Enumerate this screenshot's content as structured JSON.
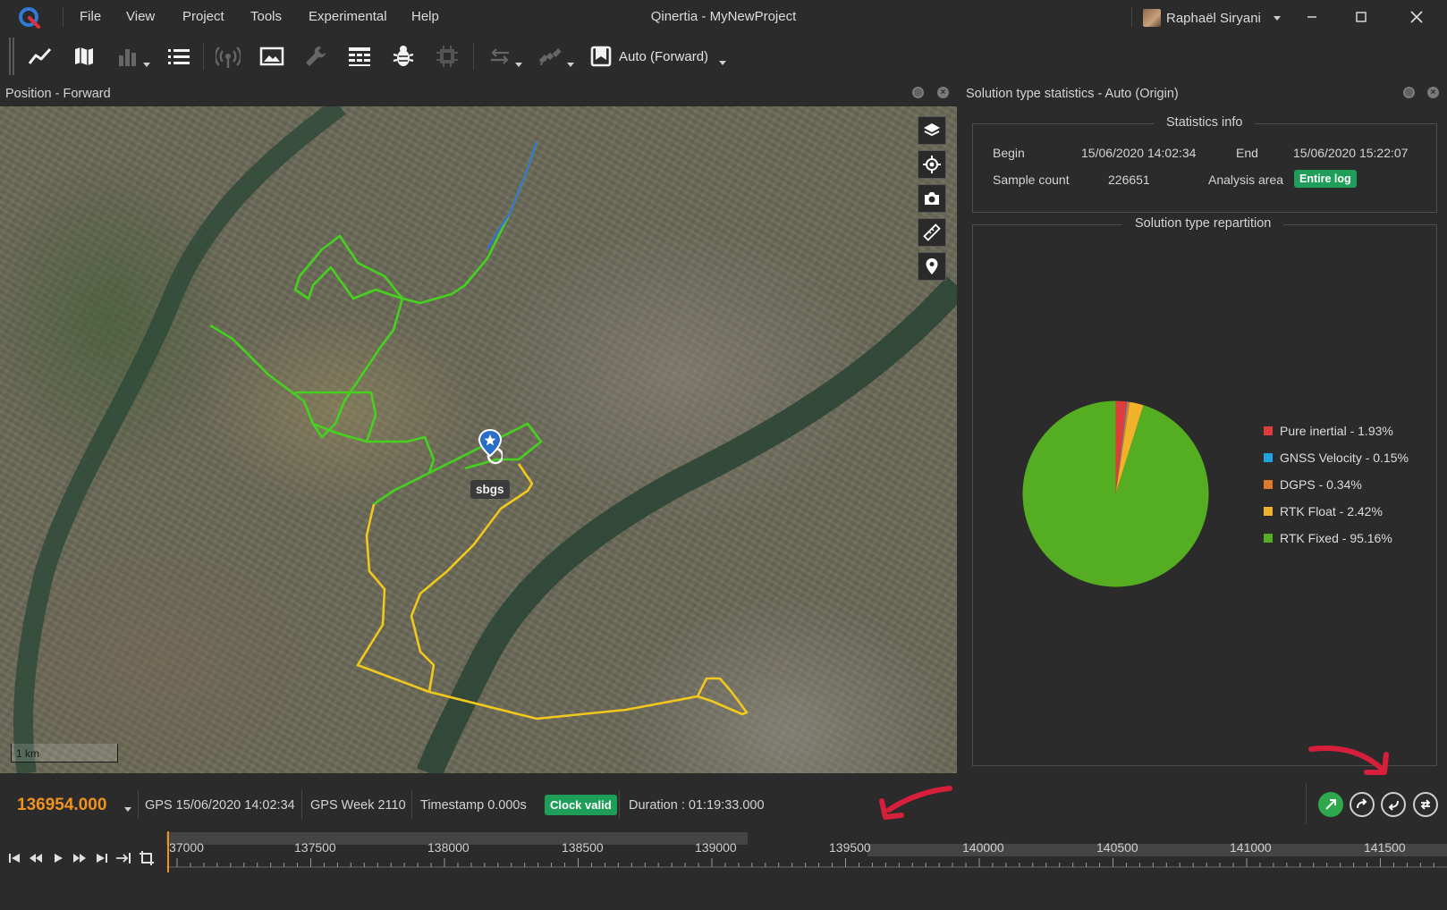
{
  "app": {
    "window_title": "Qinertia - MyNewProject",
    "user_name": "Raphaël Siryani"
  },
  "menu": [
    "File",
    "View",
    "Project",
    "Tools",
    "Experimental",
    "Help"
  ],
  "toolbar": {
    "mode_label": "Auto (Forward)",
    "icons": [
      "line-chart-icon",
      "map-icon",
      "bar-chart-icon",
      "list-icon",
      "antenna-icon",
      "image-icon",
      "wrench-icon",
      "table-icon",
      "bug-icon",
      "cpu-icon",
      "arrows-icon",
      "satellite-icon",
      "mode-icon"
    ]
  },
  "map_panel": {
    "title": "Position - Forward",
    "pin_label": "sbgs",
    "scale_label": "1 km",
    "tools": [
      "layers-icon",
      "locate-icon",
      "camera-icon",
      "ruler-icon",
      "pin-icon"
    ]
  },
  "stats_panel": {
    "title": "Solution type statistics - Auto (Origin)",
    "info_title": "Statistics info",
    "begin_label": "Begin",
    "begin_value": "15/06/2020 14:02:34",
    "end_label": "End",
    "end_value": "15/06/2020 15:22:07",
    "sample_label": "Sample count",
    "sample_value": "226651",
    "area_label": "Analysis area",
    "area_value": "Entire log",
    "repartition_title": "Solution type repartition"
  },
  "chart_data": {
    "type": "pie",
    "slices": [
      {
        "label": "Pure inertial - 1.93%",
        "value": 1.93,
        "color": "#e03c3c"
      },
      {
        "label": "GNSS Velocity - 0.15%",
        "value": 0.15,
        "color": "#1fa2e0"
      },
      {
        "label": "DGPS - 0.34%",
        "value": 0.34,
        "color": "#e07a2a"
      },
      {
        "label": "RTK Float - 2.42%",
        "value": 2.42,
        "color": "#f0b22b"
      },
      {
        "label": "RTK Fixed - 95.16%",
        "value": 95.16,
        "color": "#55ad22"
      }
    ],
    "legend_position": "right"
  },
  "status": {
    "timecode": "136954.000",
    "gps_time": "GPS 15/06/2020 14:02:34",
    "gps_week": "GPS Week 2110",
    "timestamp": "Timestamp 0.000s",
    "clock": "Clock valid",
    "duration": "Duration : 01:19:33.000"
  },
  "timeline": {
    "ticks": [
      "37000",
      "137500",
      "138000",
      "138500",
      "139000",
      "139500",
      "140000",
      "140500",
      "141000",
      "141500"
    ]
  },
  "colors": {
    "accent_orange": "#f0921e",
    "badge_green": "#1f9e5a",
    "track_green": "#45d21f",
    "track_yellow": "#f2c81c",
    "annotation_red": "#d61f3a"
  }
}
